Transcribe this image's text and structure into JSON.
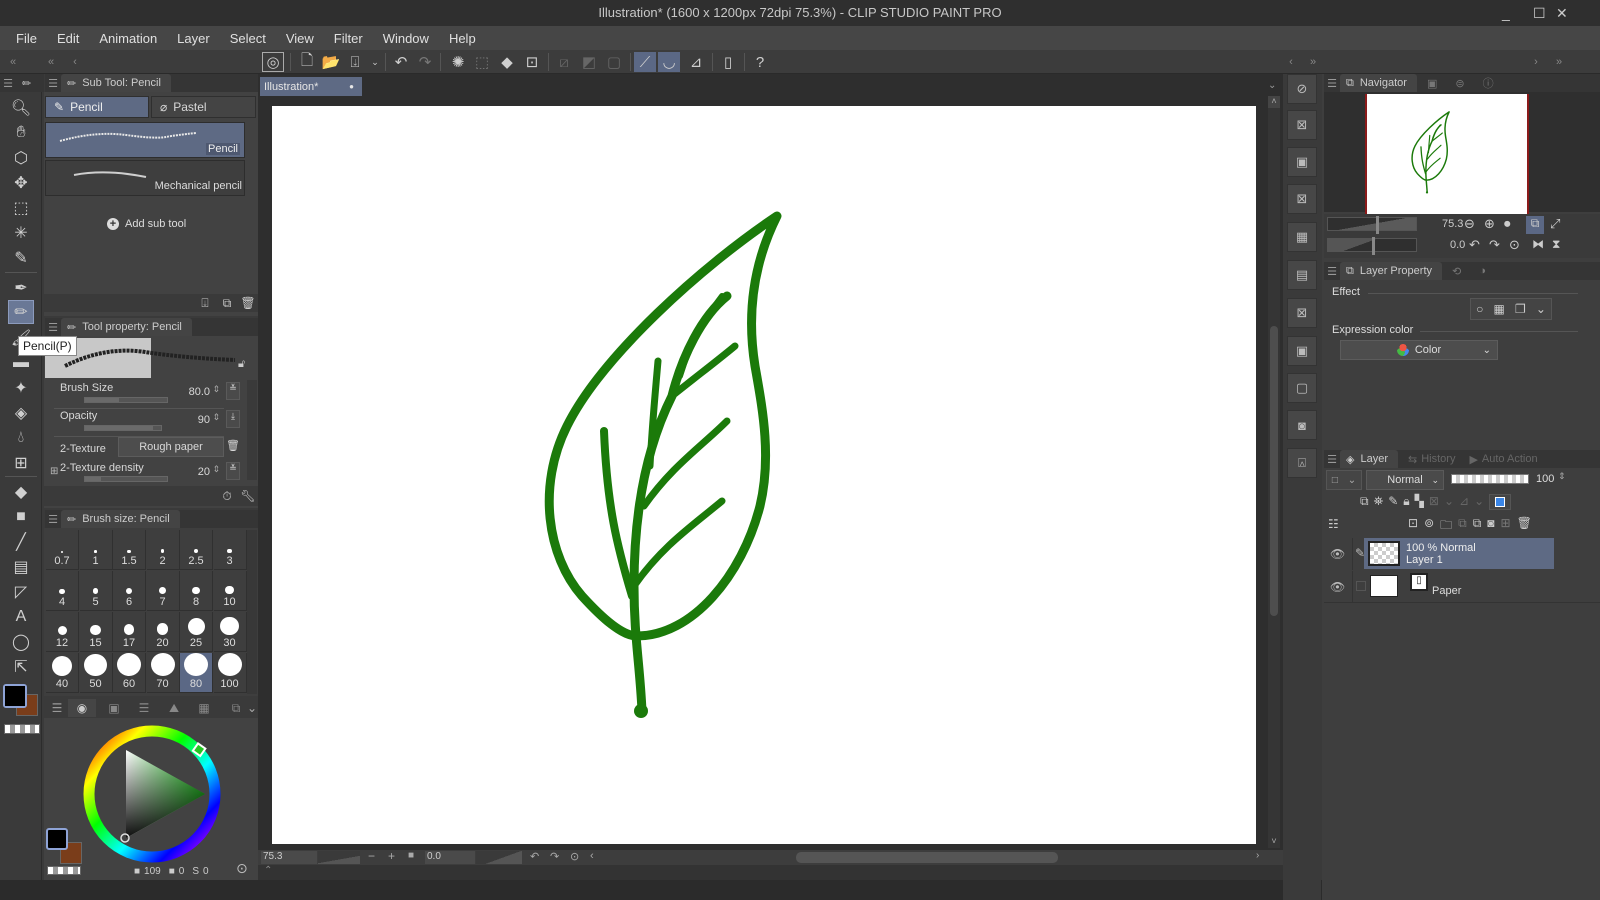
{
  "window": {
    "title": "Illustration* (1600 x 1200px 72dpi 75.3%)  - CLIP STUDIO PAINT PRO",
    "minimize": "_",
    "maximize": "☐",
    "close": "✕"
  },
  "menu": [
    "File",
    "Edit",
    "Animation",
    "Layer",
    "Select",
    "View",
    "Filter",
    "Window",
    "Help"
  ],
  "toolbar": {
    "icons": [
      "clip-studio-icon",
      "new-file-icon",
      "open-file-icon",
      "save-icon",
      "undo-icon",
      "redo-icon",
      "deselect-icon",
      "selection-icon",
      "fill-icon",
      "transform-icon",
      "snap-ruler-icon",
      "snap-special-ruler-icon",
      "snap-grid-icon",
      "ruler-icon",
      "ruler-special-icon",
      "ruler-perspective-icon",
      "smartphone-icon",
      "help-icon"
    ]
  },
  "sub_tool": {
    "header": "Sub Tool: Pencil",
    "tabs": [
      {
        "label": "Pencil",
        "active": true
      },
      {
        "label": "Pastel",
        "active": false
      }
    ],
    "items": [
      {
        "label": "Pencil",
        "active": true
      },
      {
        "label": "Mechanical pencil",
        "active": false
      }
    ],
    "add_label": "Add sub tool"
  },
  "tooltip": "Pencil(P)",
  "tool_property": {
    "header": "Tool property: Pencil",
    "brush_size": {
      "label": "Brush Size",
      "value": "80.0",
      "fraction": 0.42
    },
    "opacity": {
      "label": "Opacity",
      "value": "90",
      "fraction": 0.9
    },
    "texture": {
      "label": "2-Texture",
      "value": "Rough paper"
    },
    "texture_density": {
      "label": "2-Texture density",
      "value": "20",
      "fraction": 0.2
    }
  },
  "brush_size_panel": {
    "header": "Brush size: Pencil",
    "sizes": [
      "0.7",
      "1",
      "1.5",
      "2",
      "2.5",
      "3",
      "4",
      "5",
      "6",
      "7",
      "8",
      "10",
      "12",
      "15",
      "17",
      "20",
      "25",
      "30",
      "40",
      "50",
      "60",
      "70",
      "80",
      "100"
    ],
    "selected": "80"
  },
  "color": {
    "main": "#000000",
    "sub": "#7a3d1a",
    "hue_color": "#1e8a1a",
    "values": {
      "h": "109",
      "s": "0",
      "v": "0"
    }
  },
  "canvas": {
    "tab_label": "Illustration*",
    "stroke_color": "#1b7a0a"
  },
  "status": {
    "zoom": "75.3",
    "rotation": "0.0"
  },
  "navigator": {
    "header": "Navigator",
    "zoom": "75.3",
    "rotation": "0.0"
  },
  "layer_property": {
    "header": "Layer Property",
    "effect_label": "Effect",
    "expression_label": "Expression color",
    "expression_value": "Color"
  },
  "layer_panel": {
    "tabs": [
      "Layer",
      "History",
      "Auto Action"
    ],
    "blend_mode": "Normal",
    "opacity": "100",
    "layers": [
      {
        "mode": "100 % Normal",
        "name": "Layer 1",
        "active": true
      },
      {
        "mode": "",
        "name": "Paper",
        "active": false
      }
    ]
  }
}
